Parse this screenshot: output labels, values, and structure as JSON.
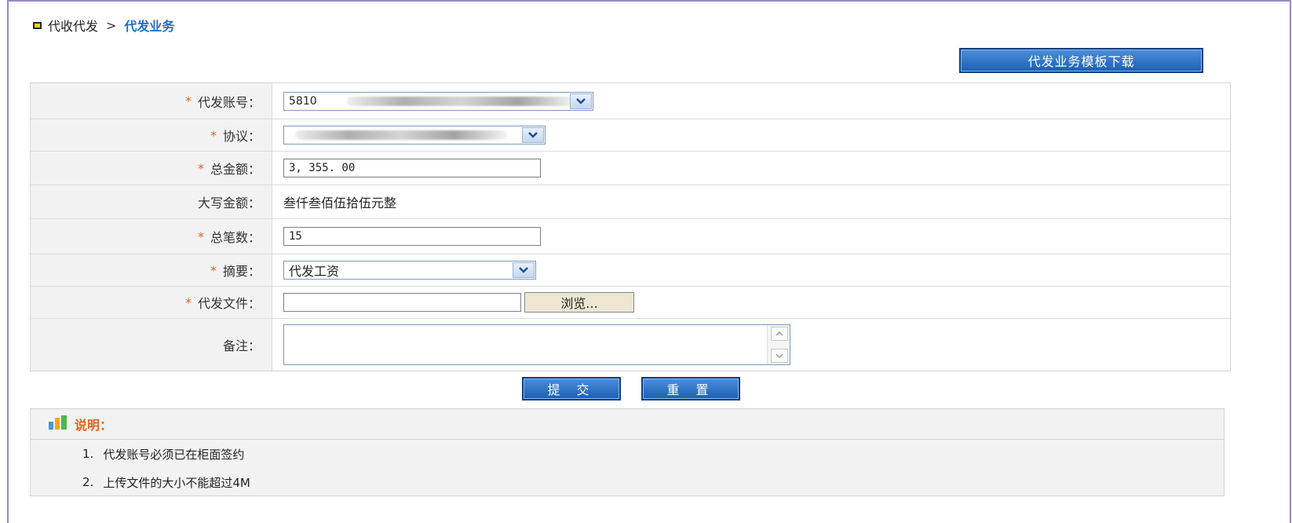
{
  "breadcrumb": {
    "parent": "代收代发",
    "separator": ">",
    "current": "代发业务"
  },
  "template_button": {
    "label": "代发业务模板下载"
  },
  "form": {
    "account": {
      "label": "代发账号：",
      "required": "*",
      "value": "5810"
    },
    "agreement": {
      "label": "协议：",
      "required": "*"
    },
    "total_amount": {
      "label": "总金额：",
      "required": "*",
      "value": "3, 355. 00"
    },
    "amount_words": {
      "label": "大写金额：",
      "value": "叁仟叁佰伍拾伍元整"
    },
    "total_count": {
      "label": "总笔数：",
      "required": "*",
      "value": "15"
    },
    "summary": {
      "label": "摘要：",
      "required": "*",
      "value": "代发工资"
    },
    "file": {
      "label": "代发文件：",
      "required": "*",
      "browse_label": "浏览..."
    },
    "remark": {
      "label": "备注："
    }
  },
  "actions": {
    "submit": "提 交",
    "reset": "重 置"
  },
  "notes": {
    "title": "说明：",
    "items": [
      {
        "num": "1.",
        "text": "代发账号必须已在柜面签约"
      },
      {
        "num": "2.",
        "text": "上传文件的大小不能超过4M"
      }
    ]
  },
  "colors": {
    "accent_blue": "#1f6fbf",
    "required_orange": "#e0641e",
    "button_blue": "#2a6cc4",
    "frame_purple": "#9b87c9"
  }
}
